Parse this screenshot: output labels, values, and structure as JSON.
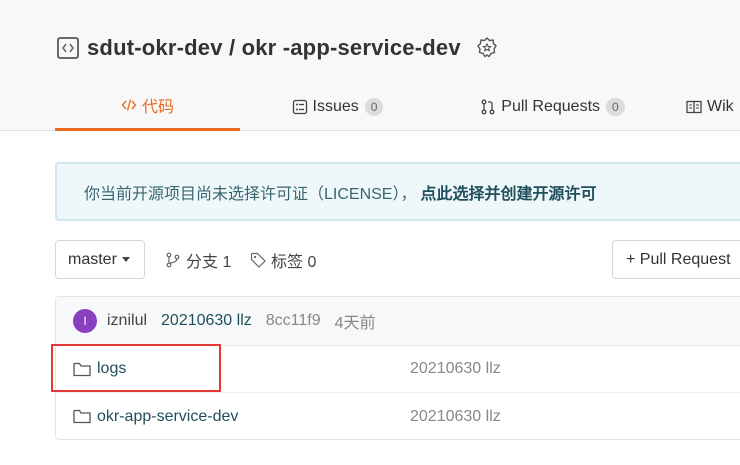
{
  "repo": {
    "title": "sdut-okr-dev / okr -app-service-dev"
  },
  "tabs": [
    {
      "icon": "code-icon",
      "label": "代码"
    },
    {
      "icon": "issues-icon",
      "label": "Issues",
      "count": "0"
    },
    {
      "icon": "pull-request-icon",
      "label": "Pull Requests",
      "count": "0"
    },
    {
      "icon": "wiki-icon",
      "label": "Wik"
    }
  ],
  "notice": {
    "text": "你当前开源项目尚未选择许可证（LICENSE），",
    "link": "点此选择并创建开源许可"
  },
  "toolbar": {
    "branch": "master",
    "branches": "分支 1",
    "tags": "标签 0",
    "pull_request_button": "+ Pull Request"
  },
  "commit": {
    "avatar_letter": "I",
    "user": "iznilul",
    "message": "20210630 llz",
    "sha": "8cc11f9",
    "time": "4天前"
  },
  "files": [
    {
      "name": "logs",
      "message": "20210630 llz"
    },
    {
      "name": "okr-app-service-dev",
      "message": "20210630 llz"
    }
  ],
  "colors": {
    "accent": "#ea6b20",
    "highlight_box": "#e53935",
    "avatar": "#8a3fbf"
  }
}
